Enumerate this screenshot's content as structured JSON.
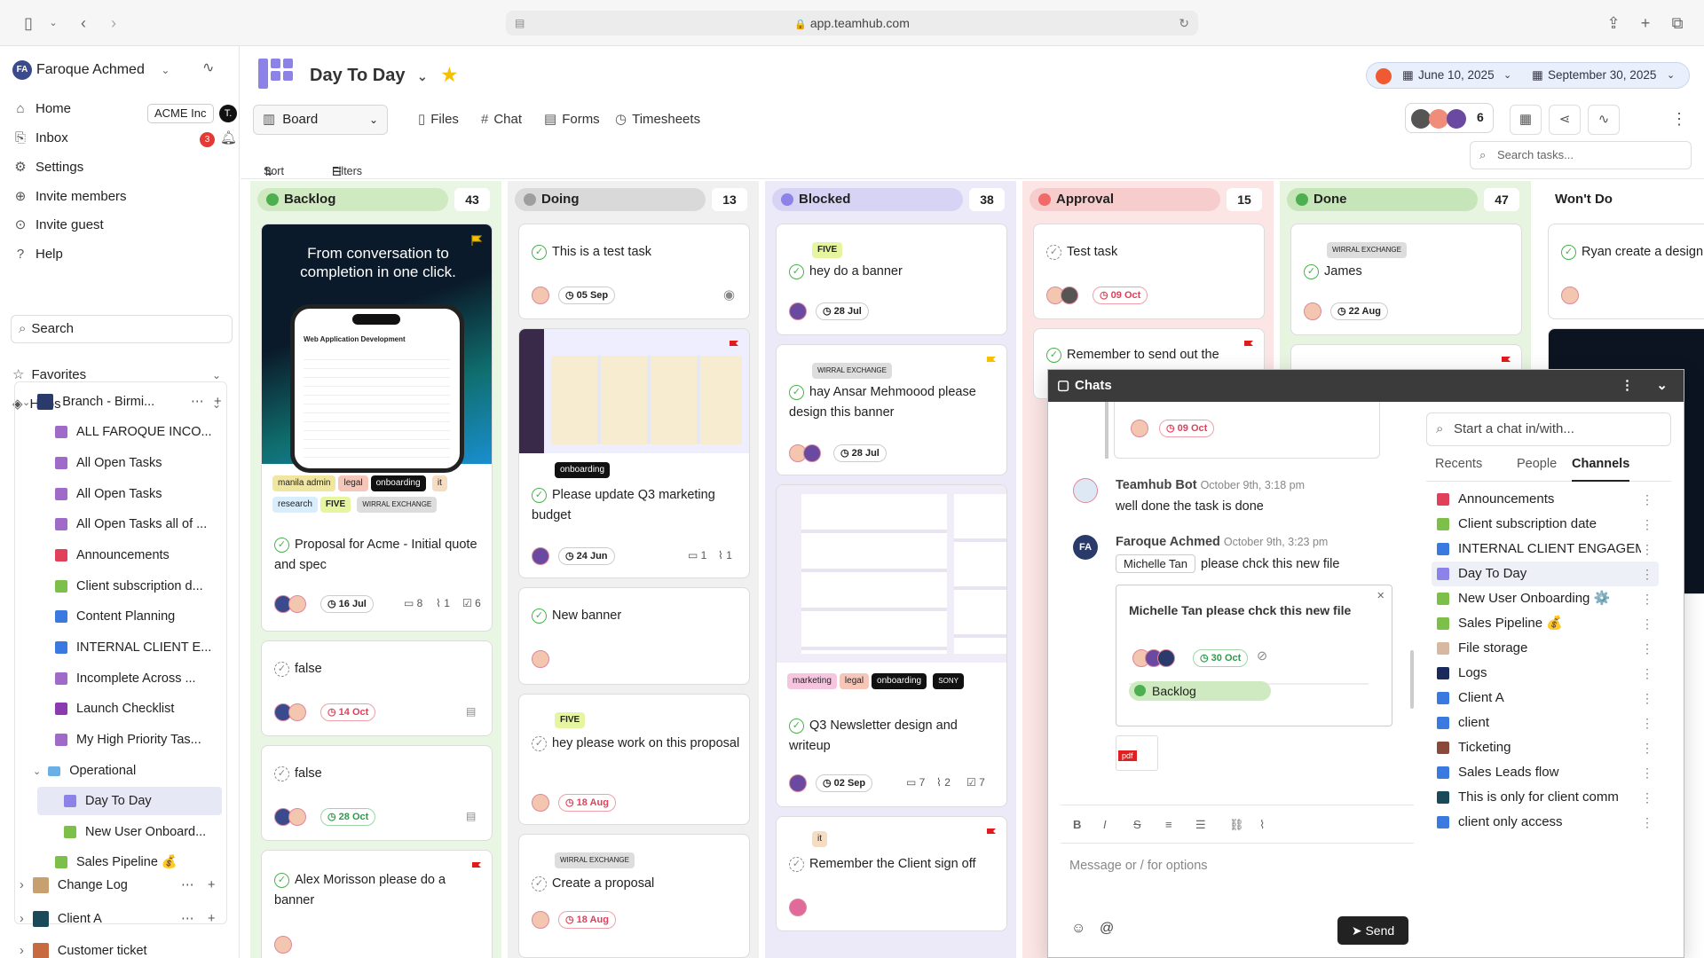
{
  "browser": {
    "url": "app.teamhub.com"
  },
  "sidebar": {
    "user": {
      "initials": "FA",
      "name": "Faroque Achmed"
    },
    "org": {
      "label": "ACME Inc",
      "initial": "T."
    },
    "nav": [
      {
        "label": "Home",
        "icon": "home-icon"
      },
      {
        "label": "Inbox",
        "icon": "inbox-icon",
        "badge": "3"
      },
      {
        "label": "Settings",
        "icon": "gear-icon"
      },
      {
        "label": "Invite members",
        "icon": "invite-icon"
      },
      {
        "label": "Invite guest",
        "icon": "guest-icon"
      },
      {
        "label": "Help",
        "icon": "help-icon"
      }
    ],
    "search_label": "Search",
    "favorites_label": "Favorites",
    "hubs_label": "Hubs",
    "tree": [
      {
        "label": "Branch - Birmi...",
        "color": "#2a3a6a"
      },
      {
        "label": "ALL FAROQUE INCO...",
        "color": "#a06ac8"
      },
      {
        "label": "All Open Tasks",
        "color": "#a06ac8"
      },
      {
        "label": "All Open Tasks",
        "color": "#a06ac8"
      },
      {
        "label": "All Open Tasks all of ...",
        "color": "#a06ac8"
      },
      {
        "label": "Announcements",
        "color": "#e0405a"
      },
      {
        "label": "Client subscription d...",
        "color": "#7cc04a"
      },
      {
        "label": "Content Planning",
        "color": "#3a7ae0"
      },
      {
        "label": "INTERNAL CLIENT E...",
        "color": "#3a7ae0"
      },
      {
        "label": "Incomplete Across ...",
        "color": "#a06ac8"
      },
      {
        "label": "Launch Checklist",
        "color": "#8b3ab0"
      },
      {
        "label": "My High Priority Tas...",
        "color": "#a06ac8"
      },
      {
        "label": "Operational",
        "color": "#6ab0e6"
      },
      {
        "label": "Day To Day",
        "color": "#8c82e8"
      },
      {
        "label": "New User Onboard...",
        "color": "#7cc04a"
      },
      {
        "label": "Sales Pipeline 💰",
        "color": "#7cc04a"
      },
      {
        "label": "Change Log",
        "color": "#c8a070"
      },
      {
        "label": "Client A",
        "color": "#1a4a5a"
      },
      {
        "label": "Customer ticket",
        "color": "#c86a40"
      }
    ]
  },
  "header": {
    "title": "Day To Day",
    "date_start": "June 10, 2025",
    "date_end": "September 30, 2025",
    "view": "Board",
    "tabs": [
      "Files",
      "Chat",
      "Forms",
      "Timesheets"
    ],
    "member_count": "6",
    "sort_label": "Sort",
    "filters_label": "Filters",
    "search_placeholder": "Search tasks..."
  },
  "columns": [
    {
      "name": "Backlog",
      "count": "43",
      "color": "#4caf50",
      "bg": "#eaf6e4",
      "head": "#cfe9c0"
    },
    {
      "name": "Doing",
      "count": "13",
      "color": "#9e9e9e",
      "bg": "#f0f0f0",
      "head": "#d9d9d9"
    },
    {
      "name": "Blocked",
      "count": "38",
      "color": "#8c82e8",
      "bg": "#eceaf9",
      "head": "#d7d3f4"
    },
    {
      "name": "Approval",
      "count": "15",
      "color": "#f06a6a",
      "bg": "#fbe5e5",
      "head": "#f6cccc"
    },
    {
      "name": "Done",
      "count": "47",
      "color": "#4caf50",
      "bg": "#e6f4e0",
      "head": "#c6e5b8"
    },
    {
      "name": "Won't Do",
      "count": "",
      "color": "#888",
      "bg": "#ffffff",
      "head": "#ffffff"
    }
  ],
  "cards": {
    "backlog": [
      {
        "promo": "From conversation to completion in one click.",
        "phone_title": "Web Application Development",
        "tags": [
          "manila admin",
          "legal",
          "onboarding",
          "it",
          "research",
          "FIVE",
          "WIRRAL EXCHANGE"
        ],
        "title": "Proposal for Acme - Initial quote and spec",
        "date": "16 Jul",
        "comments": "8",
        "attach": "1",
        "checks": "6"
      },
      {
        "title": "false",
        "date": "14 Oct"
      },
      {
        "title": "false",
        "date": "28 Oct"
      },
      {
        "title": "Alex Morisson please do a banner"
      }
    ],
    "doing": [
      {
        "title": "This is a test task",
        "date": "05 Sep"
      },
      {
        "tag": "onboarding",
        "title": "Please update Q3 marketing budget",
        "date": "24 Jun",
        "comments": "1",
        "attach": "1"
      },
      {
        "title": "New banner"
      },
      {
        "tag": "FIVE",
        "title": "hey please work on this proposal",
        "date": "18 Aug"
      },
      {
        "tag": "WIRRAL EXCHANGE",
        "title": "Create a proposal",
        "date": "18 Aug"
      }
    ],
    "blocked": [
      {
        "tag": "FIVE",
        "title": "hey do a banner",
        "date": "28 Jul"
      },
      {
        "tag": "WIRRAL EXCHANGE",
        "title": "hay Ansar Mehmoood please design this banner",
        "date": "28 Jul"
      },
      {
        "tags": [
          "marketing",
          "legal",
          "onboarding",
          "SONY"
        ],
        "title": "Q3 Newsletter design and writeup",
        "date": "02 Sep",
        "comments": "7",
        "attach": "2",
        "checks": "7"
      },
      {
        "tag": "it",
        "title": "Remember the Client sign off"
      }
    ],
    "approval": [
      {
        "title": "Test task",
        "date": "09 Oct"
      },
      {
        "title": "Remember to send out the"
      }
    ],
    "done": [
      {
        "tag": "WIRRAL EXCHANGE",
        "title": "James",
        "date": "22 Aug"
      }
    ],
    "wontdo": [
      {
        "title": "Ryan create a design"
      }
    ]
  },
  "chat": {
    "title": "Chats",
    "prev_date": "09 Oct",
    "messages": [
      {
        "name": "Teamhub Bot",
        "time": "October 9th, 3:18 pm",
        "text": "well done the task is done"
      },
      {
        "name": "Faroque Achmed",
        "time": "October 9th, 3:23 pm",
        "mention": "Michelle Tan",
        "text": "please chck this new file"
      }
    ],
    "shared_task": {
      "title": "Michelle Tan please chck this new file",
      "date": "30 Oct",
      "status": "Backlog"
    },
    "file_label": "pdf",
    "compose_placeholder": "Message or / for options",
    "send_label": "Send",
    "search_placeholder": "Start a chat in/with...",
    "tabs": [
      "Recents",
      "People",
      "Channels"
    ],
    "channels": [
      {
        "label": "Announcements",
        "color": "#e0405a"
      },
      {
        "label": "Client subscription date",
        "color": "#7cc04a"
      },
      {
        "label": "INTERNAL CLIENT ENGAGEM",
        "color": "#3a7ae0"
      },
      {
        "label": "Day To Day",
        "color": "#8c82e8"
      },
      {
        "label": "New User Onboarding ⚙️",
        "color": "#7cc04a"
      },
      {
        "label": "Sales Pipeline 💰",
        "color": "#7cc04a"
      },
      {
        "label": "File storage",
        "color": "#d8b8a0"
      },
      {
        "label": "Logs",
        "color": "#1a2a5a"
      },
      {
        "label": "Client A",
        "color": "#3a7ae0"
      },
      {
        "label": "client",
        "color": "#3a7ae0"
      },
      {
        "label": "Ticketing",
        "color": "#8a4a3a"
      },
      {
        "label": "Sales Leads flow",
        "color": "#3a7ae0"
      },
      {
        "label": "This is only for client comm",
        "color": "#1a4a5a"
      },
      {
        "label": "client only access",
        "color": "#3a7ae0"
      }
    ]
  }
}
